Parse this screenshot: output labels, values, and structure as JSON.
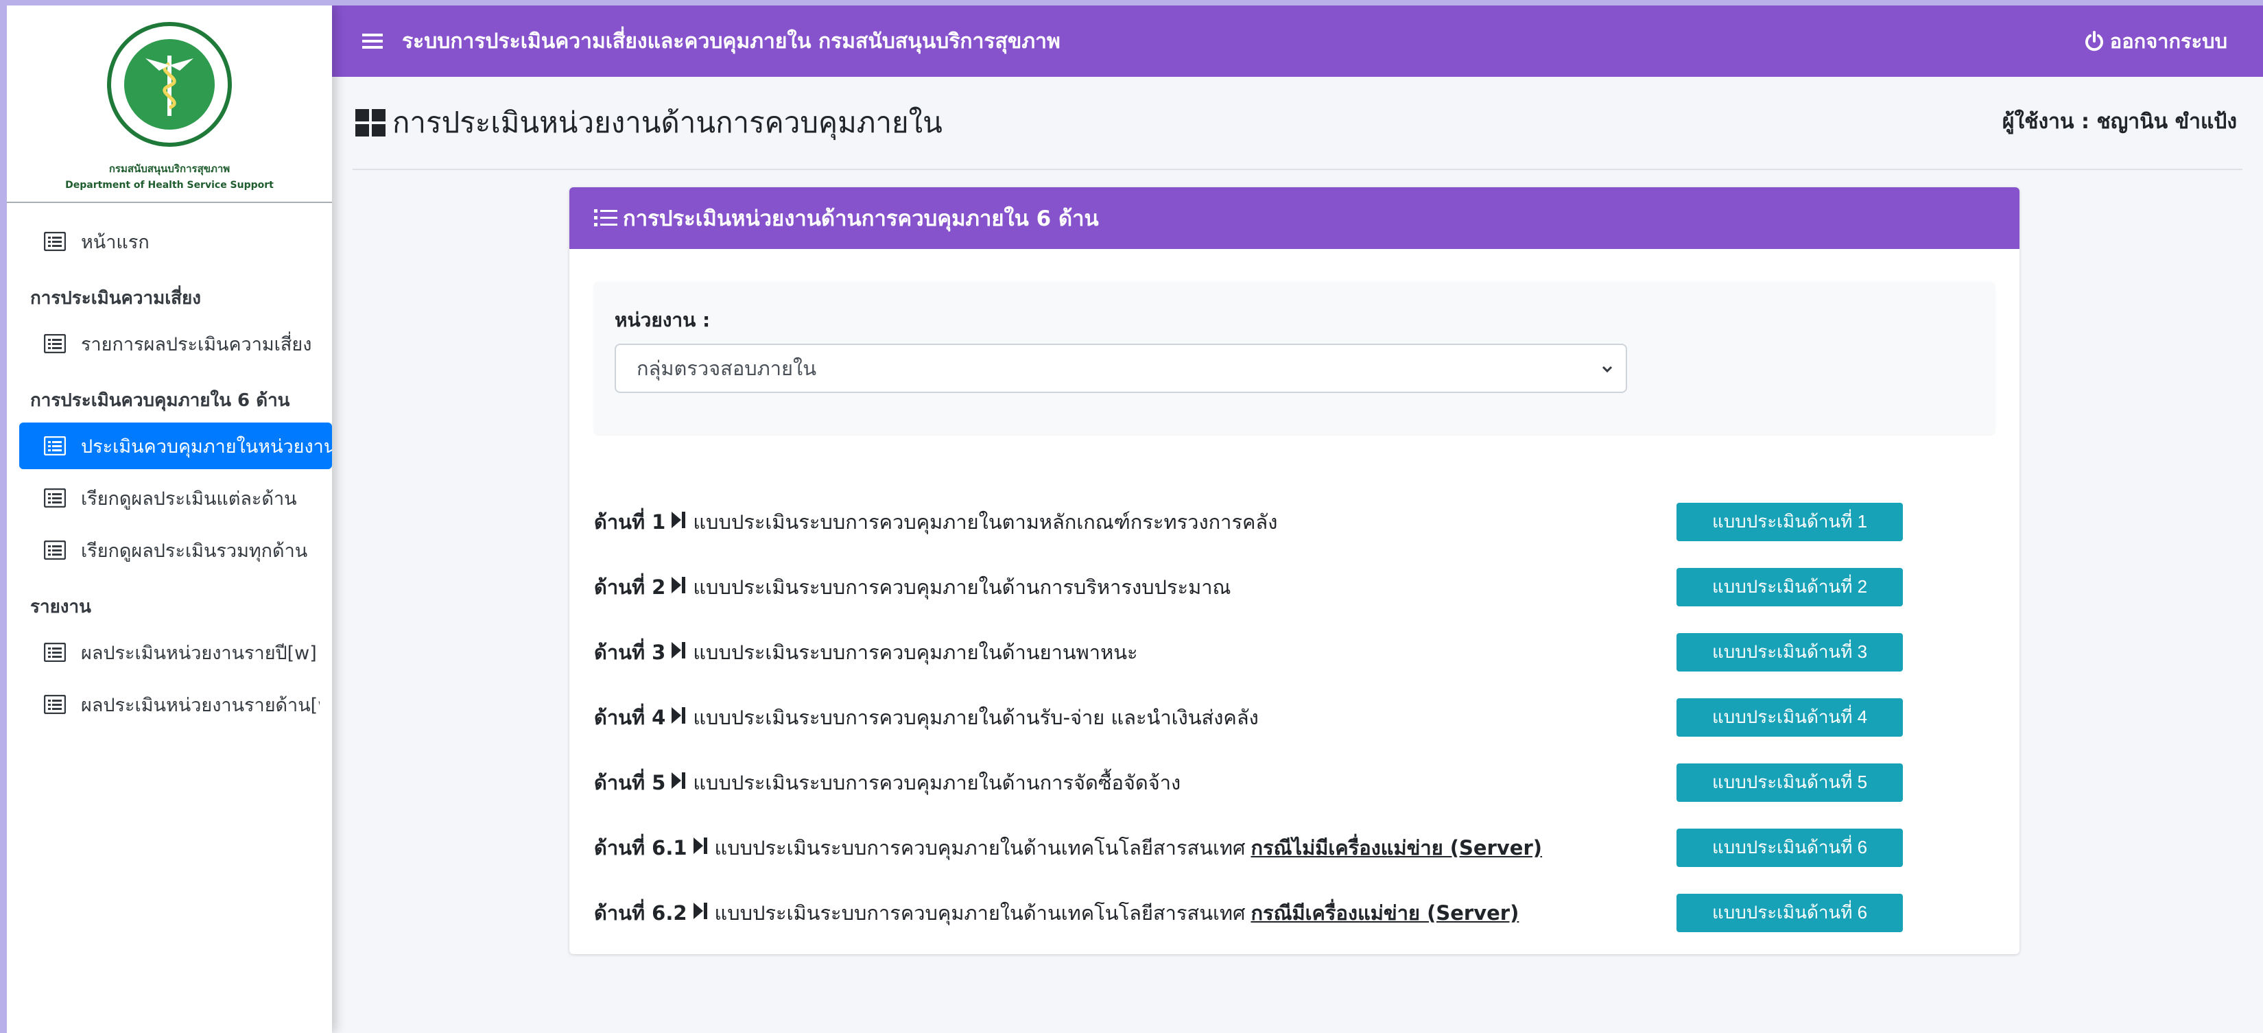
{
  "brand": {
    "name_th": "กรมสนับสนุนบริการสุขภาพ",
    "name_en": "Department of Health Service Support"
  },
  "sidebar": {
    "items": [
      {
        "type": "link",
        "label": "หน้าแรก",
        "icon": "list-icon"
      },
      {
        "type": "header",
        "label": "การประเมินความเสี่ยง"
      },
      {
        "type": "link",
        "label": "รายการผลประเมินความเสี่ยง",
        "icon": "list-icon"
      },
      {
        "type": "header",
        "label": "การประเมินควบคุมภายใน 6 ด้าน"
      },
      {
        "type": "link",
        "label": "ประเมินควบคุมภายในหน่วยงาน",
        "icon": "list-icon",
        "active": true
      },
      {
        "type": "link",
        "label": "เรียกดูผลประเมินแต่ละด้าน",
        "icon": "list-icon"
      },
      {
        "type": "link",
        "label": "เรียกดูผลประเมินรวมทุกด้าน",
        "icon": "list-icon"
      },
      {
        "type": "header",
        "label": "รายงาน"
      },
      {
        "type": "link",
        "label": "ผลประเมินหน่วยงานรายปี[w]",
        "icon": "list-icon"
      },
      {
        "type": "link",
        "label": "ผลประเมินหน่วยงานรายด้าน[w]",
        "icon": "list-icon"
      }
    ]
  },
  "topbar": {
    "title": "ระบบการประเมินความเสี่ยงและควบคุมภายใน กรมสนับสนุนบริการสุขภาพ",
    "logout_label": "ออกจากระบบ"
  },
  "header": {
    "page_title": "การประเมินหน่วยงานด้านการควบคุมภายใน",
    "user_label": "ผู้ใช้งาน : ชญานิน ขำแป้ง"
  },
  "card": {
    "title": "การประเมินหน่วยงานด้านการควบคุมภายใน 6 ด้าน",
    "unit_label": "หน่วยงาน :",
    "unit_value": "กลุ่มตรวจสอบภายใน",
    "rows": [
      {
        "prefix": "ด้านที่ 1",
        "text": "แบบประเมินระบบการควบคุมภายในตามหลักเกณฑ์กระทรวงการคลัง",
        "emph": "",
        "button": "แบบประเมินด้านที่ 1"
      },
      {
        "prefix": "ด้านที่ 2",
        "text": "แบบประเมินระบบการควบคุมภายในด้านการบริหารงบประมาณ",
        "emph": "",
        "button": "แบบประเมินด้านที่ 2"
      },
      {
        "prefix": "ด้านที่ 3",
        "text": "แบบประเมินระบบการควบคุมภายในด้านยานพาหนะ",
        "emph": "",
        "button": "แบบประเมินด้านที่ 3"
      },
      {
        "prefix": "ด้านที่ 4",
        "text": "แบบประเมินระบบการควบคุมภายในด้านรับ-จ่าย และนำเงินส่งคลัง",
        "emph": "",
        "button": "แบบประเมินด้านที่ 4"
      },
      {
        "prefix": "ด้านที่ 5",
        "text": "แบบประเมินระบบการควบคุมภายในด้านการจัดซื้อจัดจ้าง",
        "emph": "",
        "button": "แบบประเมินด้านที่ 5"
      },
      {
        "prefix": "ด้านที่ 6.1",
        "text": "แบบประเมินระบบการควบคุมภายในด้านเทคโนโลยีสารสนเทศ",
        "emph": "กรณีไม่มีเครื่องแม่ข่าย (Server)",
        "button": "แบบประเมินด้านที่ 6"
      },
      {
        "prefix": "ด้านที่ 6.2",
        "text": "แบบประเมินระบบการควบคุมภายในด้านเทคโนโลยีสารสนเทศ",
        "emph": "กรณีมีเครื่องแม่ข่าย (Server)",
        "button": "แบบประเมินด้านที่ 6"
      }
    ]
  },
  "colors": {
    "primary_purple": "#8653cd",
    "active_blue": "#007bff",
    "button_teal": "#17a2b8"
  }
}
